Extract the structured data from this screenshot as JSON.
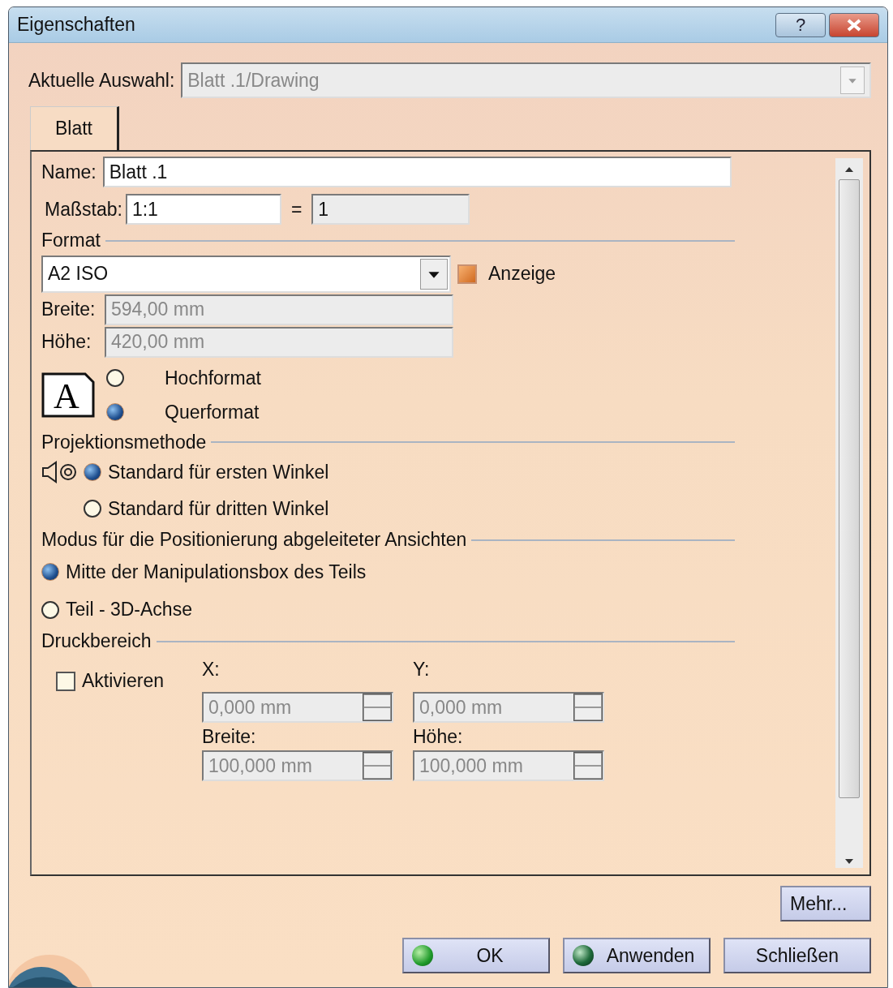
{
  "window": {
    "title": "Eigenschaften",
    "help": "?"
  },
  "selection": {
    "label": "Aktuelle Auswahl:",
    "value": "Blatt .1/Drawing",
    "disabled": true
  },
  "tabs": [
    {
      "label": "Blatt",
      "selected": true
    }
  ],
  "name": {
    "label": "Name:",
    "value": "Blatt .1"
  },
  "scale": {
    "label": "Maßstab:",
    "value": "1:1",
    "equals": "=",
    "result": "1"
  },
  "format": {
    "title": "Format",
    "value": "A2 ISO",
    "page_letter": "A",
    "display": {
      "label": "Anzeige",
      "checked": true
    },
    "width": {
      "label": "Breite:",
      "value": "594,00 mm"
    },
    "height": {
      "label": "Höhe:",
      "value": "420,00 mm"
    },
    "orientation": [
      {
        "label": "Hochformat",
        "selected": false
      },
      {
        "label": "Querformat",
        "selected": true
      }
    ]
  },
  "projection": {
    "title": "Projektionsmethode",
    "options": [
      {
        "label": "Standard für ersten Winkel",
        "selected": true,
        "kind": "symbol"
      },
      {
        "label": "Standard für dritten Winkel",
        "selected": false,
        "kind": "plain"
      }
    ]
  },
  "positioning": {
    "title": "Modus für die Positionierung abgeleiteter Ansichten",
    "options": [
      {
        "label": "Mitte der Manipulationsbox des Teils",
        "selected": true
      },
      {
        "label": "Teil - 3D-Achse",
        "selected": false
      }
    ]
  },
  "print_area": {
    "title": "Druckbereich",
    "activate": {
      "label": "Aktivieren",
      "checked": false
    },
    "fields": [
      {
        "label": "X:",
        "value": "0,000 mm"
      },
      {
        "label": "Y:",
        "value": "0,000 mm"
      },
      {
        "label": "Breite:",
        "value": "100,000 mm"
      },
      {
        "label": "Höhe:",
        "value": "100,000 mm"
      }
    ]
  },
  "buttons": [
    {
      "label": "Mehr..."
    }
  ],
  "footer_buttons": [
    {
      "label": "OK",
      "kind": "ok"
    },
    {
      "label": "Anwenden",
      "kind": "apply"
    },
    {
      "label": "Schließen",
      "kind": "plain"
    }
  ]
}
